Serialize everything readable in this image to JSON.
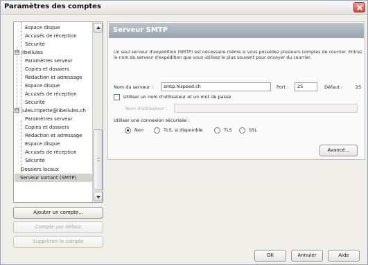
{
  "window": {
    "title": "Paramètres des comptes"
  },
  "tree": {
    "items": [
      {
        "label": "Espace disque"
      },
      {
        "label": "Accusés de réception"
      },
      {
        "label": "Sécurité"
      },
      {
        "label": "libellules",
        "expander": "⊟"
      },
      {
        "label": "Paramètres serveur"
      },
      {
        "label": "Copies et dossiers"
      },
      {
        "label": "Rédaction et adressage"
      },
      {
        "label": "Espace disque"
      },
      {
        "label": "Accusés de réception"
      },
      {
        "label": "Sécurité"
      },
      {
        "label": "jules.tripette@libellules.ch",
        "expander": "⊟"
      },
      {
        "label": "Paramètres serveur"
      },
      {
        "label": "Copies et dossiers"
      },
      {
        "label": "Rédaction et adressage"
      },
      {
        "label": "Espace disque"
      },
      {
        "label": "Accusés de réception"
      },
      {
        "label": "Sécurité"
      },
      {
        "label": "Dossiers locaux"
      },
      {
        "label": "Serveur sortant (SMTP)",
        "selected": true
      }
    ]
  },
  "left_buttons": {
    "add_account": "Ajouter un compte...",
    "default_account": "Compte par défaut",
    "delete_account": "Supprimer le compte"
  },
  "panel": {
    "title": "Serveur SMTP",
    "description": "Un seul serveur d'expédition (SMTP) est nécessaire même si vous possédez plusieurs comptes de courrier. Entrez le nom du serveur d'expédition que vous utilisez le plus souvent pour envoyer du courrier.",
    "server_name_label": "Nom du serveur :",
    "server_name_value": "smtp.hispeed.ch",
    "port_label": "Port :",
    "port_value": "25",
    "default_label": "Défaut :",
    "default_value": "25",
    "use_auth_label": "Utiliser un nom d'utilisateur et un mot de passe",
    "username_label": "Nom d'utilisateur :",
    "username_value": "",
    "secure_label": "Utiliser une connexion sécurisée :",
    "radios": [
      {
        "label": "Non",
        "checked": true
      },
      {
        "label": "TLS, si disponible",
        "checked": false
      },
      {
        "label": "TLS",
        "checked": false
      },
      {
        "label": "SSL",
        "checked": false
      }
    ],
    "advanced_button": "Avancé..."
  },
  "footer": {
    "ok": "OK",
    "cancel": "Annuler",
    "help": "Aide"
  }
}
